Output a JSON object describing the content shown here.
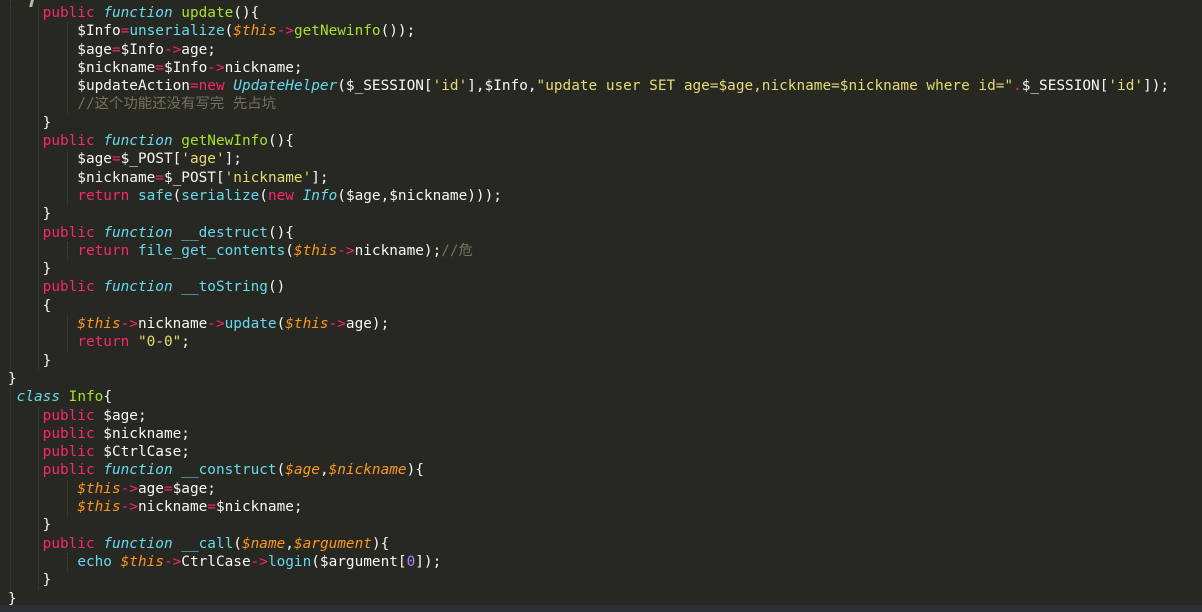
{
  "editor": {
    "language": "php",
    "background": "#272822",
    "bottom_bar_color": "#2c2f36",
    "indent_guide_color": "rgba(248,248,242,0.13)",
    "token_colors": {
      "w": {
        "color": "#f8f8f2",
        "italic": false
      },
      "k": {
        "color": "#f92672",
        "italic": false
      },
      "f": {
        "color": "#66d9ef",
        "italic": false
      },
      "fi": {
        "color": "#66d9ef",
        "italic": true
      },
      "g": {
        "color": "#a6e22e",
        "italic": false
      },
      "o": {
        "color": "#fd971f",
        "italic": true
      },
      "s": {
        "color": "#e6db74",
        "italic": false
      },
      "n": {
        "color": "#ae81ff",
        "italic": false
      },
      "c": {
        "color": "#75715e",
        "italic": false
      }
    },
    "lines": [
      [
        [
          "w",
          "    "
        ],
        [
          "k",
          "public"
        ],
        [
          "w",
          " "
        ],
        [
          "fi",
          "function"
        ],
        [
          "w",
          " "
        ],
        [
          "g",
          "update"
        ],
        [
          "w",
          "(){"
        ]
      ],
      [
        [
          "w",
          "        $Info"
        ],
        [
          "k",
          "="
        ],
        [
          "f",
          "unserialize"
        ],
        [
          "w",
          "("
        ],
        [
          "o",
          "$this"
        ],
        [
          "k",
          "->"
        ],
        [
          "g",
          "getNewinfo"
        ],
        [
          "w",
          "());"
        ]
      ],
      [
        [
          "w",
          "        $age"
        ],
        [
          "k",
          "="
        ],
        [
          "w",
          "$Info"
        ],
        [
          "k",
          "->"
        ],
        [
          "w",
          "age;"
        ]
      ],
      [
        [
          "w",
          "        $nickname"
        ],
        [
          "k",
          "="
        ],
        [
          "w",
          "$Info"
        ],
        [
          "k",
          "->"
        ],
        [
          "w",
          "nickname;"
        ]
      ],
      [
        [
          "w",
          "        $updateAction"
        ],
        [
          "k",
          "="
        ],
        [
          "k",
          "new"
        ],
        [
          "w",
          " "
        ],
        [
          "fi",
          "UpdateHelper"
        ],
        [
          "w",
          "($_SESSION["
        ],
        [
          "s",
          "'id'"
        ],
        [
          "w",
          "],$Info,"
        ],
        [
          "s",
          "\"update user SET age=$age,nickname=$nickname where id=\""
        ],
        [
          "k",
          "."
        ],
        [
          "w",
          "$_SESSION["
        ],
        [
          "s",
          "'id'"
        ],
        [
          "w",
          "]);"
        ]
      ],
      [
        [
          "w",
          "        "
        ],
        [
          "c",
          "//这个功能还没有写完 先占坑"
        ]
      ],
      [
        [
          "w",
          "    }"
        ]
      ],
      [
        [
          "w",
          "    "
        ],
        [
          "k",
          "public"
        ],
        [
          "w",
          " "
        ],
        [
          "fi",
          "function"
        ],
        [
          "w",
          " "
        ],
        [
          "g",
          "getNewInfo"
        ],
        [
          "w",
          "(){"
        ]
      ],
      [
        [
          "w",
          "        $age"
        ],
        [
          "k",
          "="
        ],
        [
          "w",
          "$_POST["
        ],
        [
          "s",
          "'age'"
        ],
        [
          "w",
          "];"
        ]
      ],
      [
        [
          "w",
          "        $nickname"
        ],
        [
          "k",
          "="
        ],
        [
          "w",
          "$_POST["
        ],
        [
          "s",
          "'nickname'"
        ],
        [
          "w",
          "];"
        ]
      ],
      [
        [
          "w",
          "        "
        ],
        [
          "k",
          "return"
        ],
        [
          "w",
          " "
        ],
        [
          "f",
          "safe"
        ],
        [
          "w",
          "("
        ],
        [
          "f",
          "serialize"
        ],
        [
          "w",
          "("
        ],
        [
          "k",
          "new"
        ],
        [
          "w",
          " "
        ],
        [
          "fi",
          "Info"
        ],
        [
          "w",
          "($age,$nickname)));"
        ]
      ],
      [
        [
          "w",
          "    }"
        ]
      ],
      [
        [
          "w",
          "    "
        ],
        [
          "k",
          "public"
        ],
        [
          "w",
          " "
        ],
        [
          "fi",
          "function"
        ],
        [
          "w",
          " "
        ],
        [
          "f",
          "__destruct"
        ],
        [
          "w",
          "(){"
        ]
      ],
      [
        [
          "w",
          "        "
        ],
        [
          "k",
          "return"
        ],
        [
          "w",
          " "
        ],
        [
          "f",
          "file_get_contents"
        ],
        [
          "w",
          "("
        ],
        [
          "o",
          "$this"
        ],
        [
          "k",
          "->"
        ],
        [
          "w",
          "nickname);"
        ],
        [
          "c",
          "//危"
        ]
      ],
      [
        [
          "w",
          "    }"
        ]
      ],
      [
        [
          "w",
          "    "
        ],
        [
          "k",
          "public"
        ],
        [
          "w",
          " "
        ],
        [
          "fi",
          "function"
        ],
        [
          "w",
          " "
        ],
        [
          "f",
          "__toString"
        ],
        [
          "w",
          "()"
        ]
      ],
      [
        [
          "w",
          "    {"
        ]
      ],
      [
        [
          "w",
          "        "
        ],
        [
          "o",
          "$this"
        ],
        [
          "k",
          "->"
        ],
        [
          "w",
          "nickname"
        ],
        [
          "k",
          "->"
        ],
        [
          "f",
          "update"
        ],
        [
          "w",
          "("
        ],
        [
          "o",
          "$this"
        ],
        [
          "k",
          "->"
        ],
        [
          "w",
          "age);"
        ]
      ],
      [
        [
          "w",
          "        "
        ],
        [
          "k",
          "return"
        ],
        [
          "w",
          " "
        ],
        [
          "s",
          "\"0-0\""
        ],
        [
          "w",
          ";"
        ]
      ],
      [
        [
          "w",
          "    }"
        ]
      ],
      [
        [
          "w",
          "}"
        ]
      ],
      [
        [
          "w",
          " "
        ],
        [
          "fi",
          "class"
        ],
        [
          "w",
          " "
        ],
        [
          "g",
          "Info"
        ],
        [
          "w",
          "{"
        ]
      ],
      [
        [
          "w",
          "    "
        ],
        [
          "k",
          "public"
        ],
        [
          "w",
          " $age;"
        ]
      ],
      [
        [
          "w",
          "    "
        ],
        [
          "k",
          "public"
        ],
        [
          "w",
          " $nickname;"
        ]
      ],
      [
        [
          "w",
          "    "
        ],
        [
          "k",
          "public"
        ],
        [
          "w",
          " $CtrlCase;"
        ]
      ],
      [
        [
          "w",
          "    "
        ],
        [
          "k",
          "public"
        ],
        [
          "w",
          " "
        ],
        [
          "fi",
          "function"
        ],
        [
          "w",
          " "
        ],
        [
          "f",
          "__construct"
        ],
        [
          "w",
          "("
        ],
        [
          "o",
          "$age"
        ],
        [
          "w",
          ","
        ],
        [
          "o",
          "$nickname"
        ],
        [
          "w",
          "){"
        ]
      ],
      [
        [
          "w",
          "        "
        ],
        [
          "o",
          "$this"
        ],
        [
          "k",
          "->"
        ],
        [
          "w",
          "age"
        ],
        [
          "k",
          "="
        ],
        [
          "w",
          "$age;"
        ]
      ],
      [
        [
          "w",
          "        "
        ],
        [
          "o",
          "$this"
        ],
        [
          "k",
          "->"
        ],
        [
          "w",
          "nickname"
        ],
        [
          "k",
          "="
        ],
        [
          "w",
          "$nickname;"
        ]
      ],
      [
        [
          "w",
          "    }"
        ]
      ],
      [
        [
          "w",
          "    "
        ],
        [
          "k",
          "public"
        ],
        [
          "w",
          " "
        ],
        [
          "fi",
          "function"
        ],
        [
          "w",
          " "
        ],
        [
          "f",
          "__call"
        ],
        [
          "w",
          "("
        ],
        [
          "o",
          "$name"
        ],
        [
          "w",
          ","
        ],
        [
          "o",
          "$argument"
        ],
        [
          "w",
          "){"
        ]
      ],
      [
        [
          "w",
          "        "
        ],
        [
          "f",
          "echo"
        ],
        [
          "w",
          " "
        ],
        [
          "o",
          "$this"
        ],
        [
          "k",
          "->"
        ],
        [
          "w",
          "CtrlCase"
        ],
        [
          "k",
          "->"
        ],
        [
          "f",
          "login"
        ],
        [
          "w",
          "($argument["
        ],
        [
          "n",
          "0"
        ],
        [
          "w",
          "]);"
        ]
      ],
      [
        [
          "w",
          "    }"
        ]
      ],
      [
        [
          "w",
          "}"
        ]
      ]
    ]
  }
}
